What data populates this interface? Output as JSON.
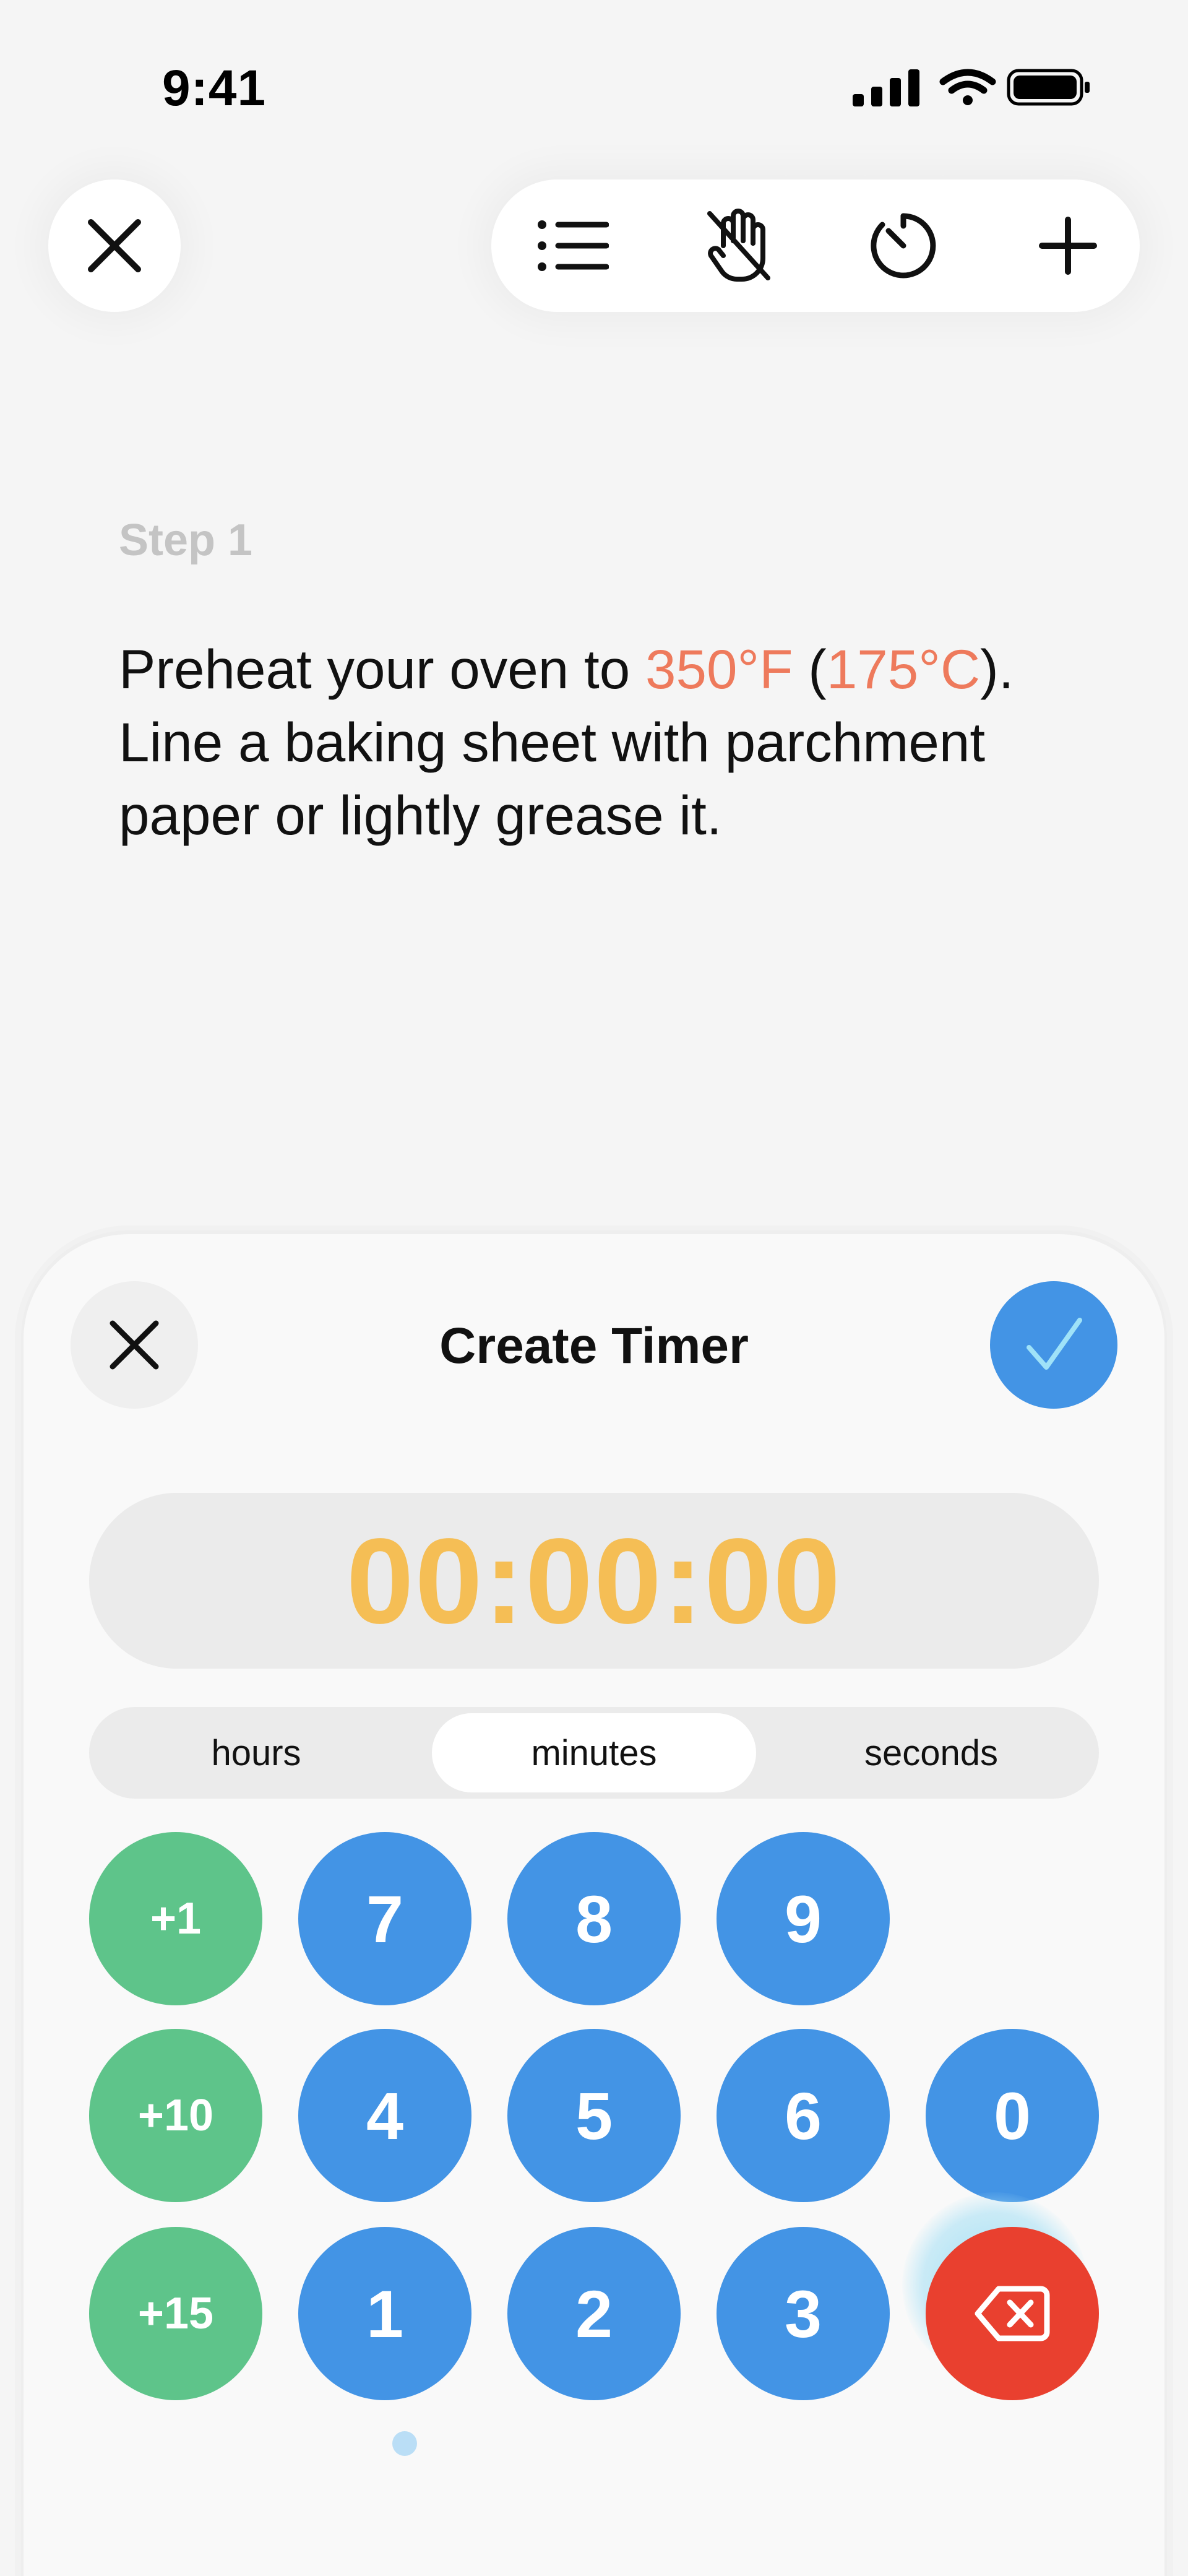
{
  "status_bar": {
    "time": "9:41",
    "icons": [
      "signal-icon",
      "wifi-icon",
      "battery-icon"
    ]
  },
  "top_bar": {
    "close_icon": "close-icon",
    "toolbar_icons": [
      "list-icon",
      "hand-off-icon",
      "timer-icon",
      "plus-icon"
    ]
  },
  "step": {
    "label": "Step 1",
    "text_part1": "Preheat your oven to ",
    "temp_f": "350°F",
    "text_part2": " (",
    "temp_c": "175°C",
    "text_part3": "). Line a baking sheet with parchment paper or lightly grease it."
  },
  "timer_sheet": {
    "title": "Create Timer",
    "display": "00:00:00",
    "units": [
      "hours",
      "minutes",
      "seconds"
    ],
    "selected_unit": "minutes",
    "increment_keys": [
      "+1",
      "+10",
      "+15"
    ],
    "number_keys": [
      "7",
      "8",
      "9",
      "4",
      "5",
      "6",
      "0",
      "1",
      "2",
      "3"
    ],
    "delete_icon": "backspace-icon"
  },
  "colors": {
    "accent_blue": "#4394e5",
    "increment_green": "#5ec48a",
    "delete_red": "#e9402f",
    "timer_yellow": "#f5be55",
    "temperature_orange": "#ee7a5c"
  }
}
